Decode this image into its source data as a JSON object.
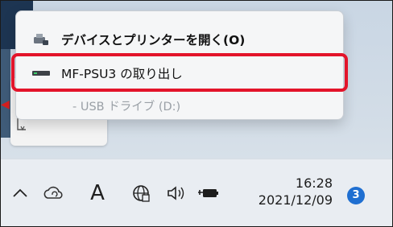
{
  "context_menu": {
    "items": [
      {
        "label": "デバイスとプリンターを開く(O)",
        "icon": "printer-devices-icon"
      },
      {
        "label": "MF-PSU3 の取り出し",
        "icon": "usb-drive-icon"
      },
      {
        "label": "- USB ドライブ (D:)",
        "icon": ""
      }
    ]
  },
  "taskbar": {
    "ime_label": "A",
    "icons": [
      "chevron-up-icon",
      "onedrive-icon",
      "network-icon",
      "volume-icon",
      "battery-icon"
    ],
    "clock": {
      "time": "16:28",
      "date": "2021/12/09"
    },
    "notification_count": "3"
  },
  "colors": {
    "highlight_border": "#e3142a",
    "badge": "#1f6fd1",
    "menu_background": "#f5f6f7",
    "taskbar_background": "#e9edf2"
  }
}
